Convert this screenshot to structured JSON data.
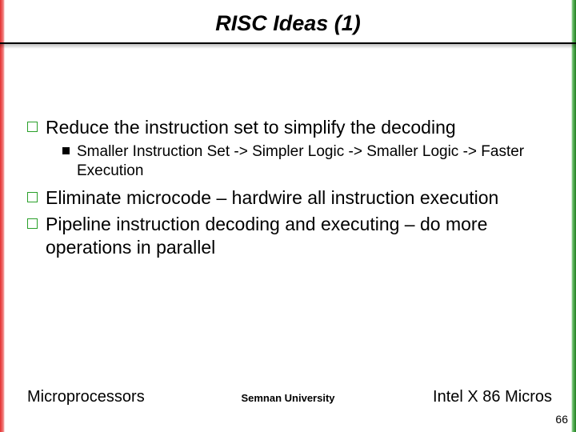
{
  "title": "RISC Ideas (1)",
  "bullets": {
    "b1": "Reduce the instruction set to simplify the decoding",
    "b1_sub": "Smaller Instruction Set -> Simpler Logic -> Smaller Logic -> Faster Execution",
    "b2": "Eliminate microcode – hardwire all instruction execution",
    "b3": "Pipeline instruction decoding and executing – do more operations in parallel"
  },
  "footer": {
    "left": "Microprocessors",
    "center": "Semnan University",
    "right": "Intel X 86 Micros"
  },
  "page": "66"
}
